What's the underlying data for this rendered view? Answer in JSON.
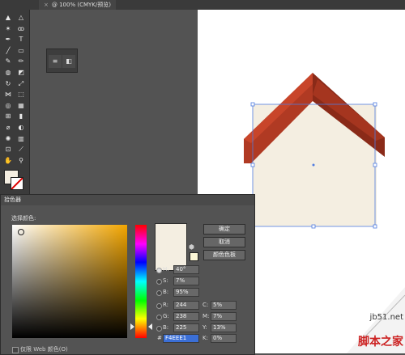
{
  "document": {
    "tab_title": "@ 100% (CMYK/预览)",
    "close_glyph": "×"
  },
  "toolbar": {
    "tools": [
      {
        "icon": "selection-tool-icon",
        "glyph": "▲"
      },
      {
        "icon": "direct-selection-tool-icon",
        "glyph": "△"
      },
      {
        "icon": "magic-wand-tool-icon",
        "glyph": "✶"
      },
      {
        "icon": "lasso-tool-icon",
        "glyph": "ꝏ"
      },
      {
        "icon": "pen-tool-icon",
        "glyph": "✒"
      },
      {
        "icon": "type-tool-icon",
        "glyph": "T"
      },
      {
        "icon": "line-tool-icon",
        "glyph": "╱"
      },
      {
        "icon": "rectangle-tool-icon",
        "glyph": "▭"
      },
      {
        "icon": "paintbrush-tool-icon",
        "glyph": "✎"
      },
      {
        "icon": "pencil-tool-icon",
        "glyph": "✏"
      },
      {
        "icon": "blob-brush-tool-icon",
        "glyph": "◍"
      },
      {
        "icon": "eraser-tool-icon",
        "glyph": "◩"
      },
      {
        "icon": "rotate-tool-icon",
        "glyph": "↻"
      },
      {
        "icon": "scale-tool-icon",
        "glyph": "⤢"
      },
      {
        "icon": "width-tool-icon",
        "glyph": "⋈"
      },
      {
        "icon": "free-transform-tool-icon",
        "glyph": "⬚"
      },
      {
        "icon": "shape-builder-tool-icon",
        "glyph": "◎"
      },
      {
        "icon": "perspective-grid-tool-icon",
        "glyph": "▦"
      },
      {
        "icon": "mesh-tool-icon",
        "glyph": "⊞"
      },
      {
        "icon": "gradient-tool-icon",
        "glyph": "▮"
      },
      {
        "icon": "eyedropper-tool-icon",
        "glyph": "⌀"
      },
      {
        "icon": "blend-tool-icon",
        "glyph": "◐"
      },
      {
        "icon": "symbol-sprayer-tool-icon",
        "glyph": "✺"
      },
      {
        "icon": "column-graph-tool-icon",
        "glyph": "▥"
      },
      {
        "icon": "artboard-tool-icon",
        "glyph": "⊡"
      },
      {
        "icon": "slice-tool-icon",
        "glyph": "⟋"
      },
      {
        "icon": "hand-tool-icon",
        "glyph": "✋"
      },
      {
        "icon": "zoom-tool-icon",
        "glyph": "⚲"
      }
    ]
  },
  "minipanel": {
    "left_glyph": "≡",
    "right_glyph": "◧"
  },
  "colors": {
    "selected_fill": "#F4EEE1",
    "roof_main": "#B03A23",
    "roof_light": "#D6492B",
    "roof_dark": "#8A2A18",
    "selection": "#4F7CE0"
  },
  "picker": {
    "title": "拾色器",
    "section_label": "选择颜色:",
    "buttons": {
      "ok": "确定",
      "cancel": "取消",
      "swatches": "颜色色板"
    },
    "hsb": [
      {
        "label": "H:",
        "value": "40°",
        "selected": true
      },
      {
        "label": "S:",
        "value": "7%",
        "selected": false
      },
      {
        "label": "B:",
        "value": "95%",
        "selected": false
      }
    ],
    "rgb": [
      {
        "label": "R:",
        "value": "244"
      },
      {
        "label": "G:",
        "value": "238"
      },
      {
        "label": "B:",
        "value": "225"
      }
    ],
    "cmyk": [
      {
        "label": "C:",
        "value": "5%"
      },
      {
        "label": "M:",
        "value": "7%"
      },
      {
        "label": "Y:",
        "value": "13%"
      },
      {
        "label": "K:",
        "value": "0%"
      }
    ],
    "hex_label": "#",
    "hex_value": "F4EEE1",
    "websafe_label": "仅限 Web 颜色(O)"
  },
  "watermark": {
    "site": "jb51.net",
    "name": "脚本之家"
  }
}
